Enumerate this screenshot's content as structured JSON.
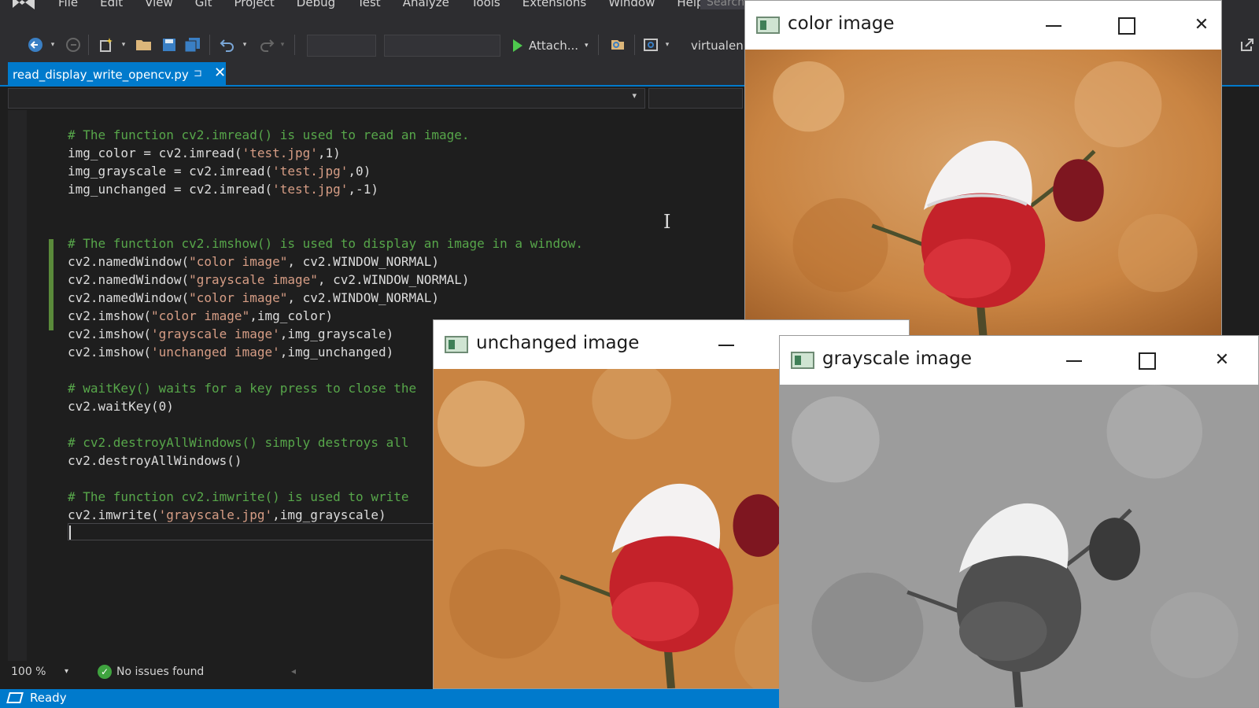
{
  "menu": {
    "items": [
      "File",
      "Edit",
      "View",
      "Git",
      "Project",
      "Debug",
      "Test",
      "Analyze",
      "Tools",
      "Extensions",
      "Window",
      "Help"
    ],
    "search_placeholder": "Search"
  },
  "toolbar": {
    "attach_label": "Attach...",
    "environment": "virtualen"
  },
  "tab": {
    "filename": "read_display_write_opencv.py"
  },
  "code_lines": [
    {
      "segments": [
        {
          "t": "# The function cv2.imread() is used to read an image.",
          "c": "cm"
        }
      ]
    },
    {
      "segments": [
        {
          "t": "img_color = ",
          "c": "fn"
        },
        {
          "t": "cv2",
          "c": "fn"
        },
        {
          "t": ".imread(",
          "c": "fn"
        },
        {
          "t": "'test.jpg'",
          "c": "st"
        },
        {
          "t": ",1)",
          "c": "fn"
        }
      ]
    },
    {
      "segments": [
        {
          "t": "img_grayscale = ",
          "c": "fn"
        },
        {
          "t": "cv2",
          "c": "fn"
        },
        {
          "t": ".imread(",
          "c": "fn"
        },
        {
          "t": "'test.jpg'",
          "c": "st"
        },
        {
          "t": ",0)",
          "c": "fn"
        }
      ]
    },
    {
      "segments": [
        {
          "t": "img_unchanged = ",
          "c": "fn"
        },
        {
          "t": "cv2",
          "c": "fn"
        },
        {
          "t": ".imread(",
          "c": "fn"
        },
        {
          "t": "'test.jpg'",
          "c": "st"
        },
        {
          "t": ",-1)",
          "c": "fn"
        }
      ]
    },
    {
      "segments": [
        {
          "t": "",
          "c": "fn"
        }
      ]
    },
    {
      "segments": [
        {
          "t": "",
          "c": "fn"
        }
      ]
    },
    {
      "segments": [
        {
          "t": "# The function cv2.imshow() is used to display an image in a window.",
          "c": "cm"
        }
      ]
    },
    {
      "segments": [
        {
          "t": "cv2.namedWindow(",
          "c": "fn"
        },
        {
          "t": "\"color image\"",
          "c": "st"
        },
        {
          "t": ", cv2.WINDOW_NORMAL)",
          "c": "fn"
        }
      ]
    },
    {
      "segments": [
        {
          "t": "cv2.namedWindow(",
          "c": "fn"
        },
        {
          "t": "\"grayscale image\"",
          "c": "st"
        },
        {
          "t": ", cv2.WINDOW_NORMAL)",
          "c": "fn"
        }
      ]
    },
    {
      "segments": [
        {
          "t": "cv2.namedWindow(",
          "c": "fn"
        },
        {
          "t": "\"color image\"",
          "c": "st"
        },
        {
          "t": ", cv2.WINDOW_NORMAL)",
          "c": "fn"
        }
      ]
    },
    {
      "segments": [
        {
          "t": "cv2.imshow(",
          "c": "fn"
        },
        {
          "t": "\"color image\"",
          "c": "st"
        },
        {
          "t": ",img_color)",
          "c": "fn"
        }
      ]
    },
    {
      "segments": [
        {
          "t": "cv2.imshow(",
          "c": "fn"
        },
        {
          "t": "'grayscale image'",
          "c": "st"
        },
        {
          "t": ",img_grayscale)",
          "c": "fn"
        }
      ]
    },
    {
      "segments": [
        {
          "t": "cv2.imshow(",
          "c": "fn"
        },
        {
          "t": "'unchanged image'",
          "c": "st"
        },
        {
          "t": ",img_unchanged)",
          "c": "fn"
        }
      ]
    },
    {
      "segments": [
        {
          "t": "",
          "c": "fn"
        }
      ]
    },
    {
      "segments": [
        {
          "t": "# waitKey() waits for a key press to close the",
          "c": "cm"
        }
      ]
    },
    {
      "segments": [
        {
          "t": "cv2.waitKey(0)",
          "c": "fn"
        }
      ]
    },
    {
      "segments": [
        {
          "t": "",
          "c": "fn"
        }
      ]
    },
    {
      "segments": [
        {
          "t": "# cv2.destroyAllWindows() simply destroys all",
          "c": "cm"
        }
      ]
    },
    {
      "segments": [
        {
          "t": "cv2.destroyAllWindows()",
          "c": "fn"
        }
      ]
    },
    {
      "segments": [
        {
          "t": "",
          "c": "fn"
        }
      ]
    },
    {
      "segments": [
        {
          "t": "# The function cv2.imwrite() is used to write",
          "c": "cm"
        }
      ]
    },
    {
      "segments": [
        {
          "t": "cv2.imwrite(",
          "c": "fn"
        },
        {
          "t": "'grayscale.jpg'",
          "c": "st"
        },
        {
          "t": ",img_grayscale)",
          "c": "fn"
        }
      ]
    }
  ],
  "editor_status": {
    "zoom": "100 %",
    "issues": "No issues found"
  },
  "statusbar": {
    "text": "Ready"
  },
  "windows": {
    "color": {
      "title": "color image"
    },
    "unchanged": {
      "title": "unchanged image"
    },
    "grayscale": {
      "title": "grayscale image"
    }
  },
  "colors": {
    "accent": "#007acc",
    "comment": "#57a64a",
    "string": "#d69d85"
  }
}
